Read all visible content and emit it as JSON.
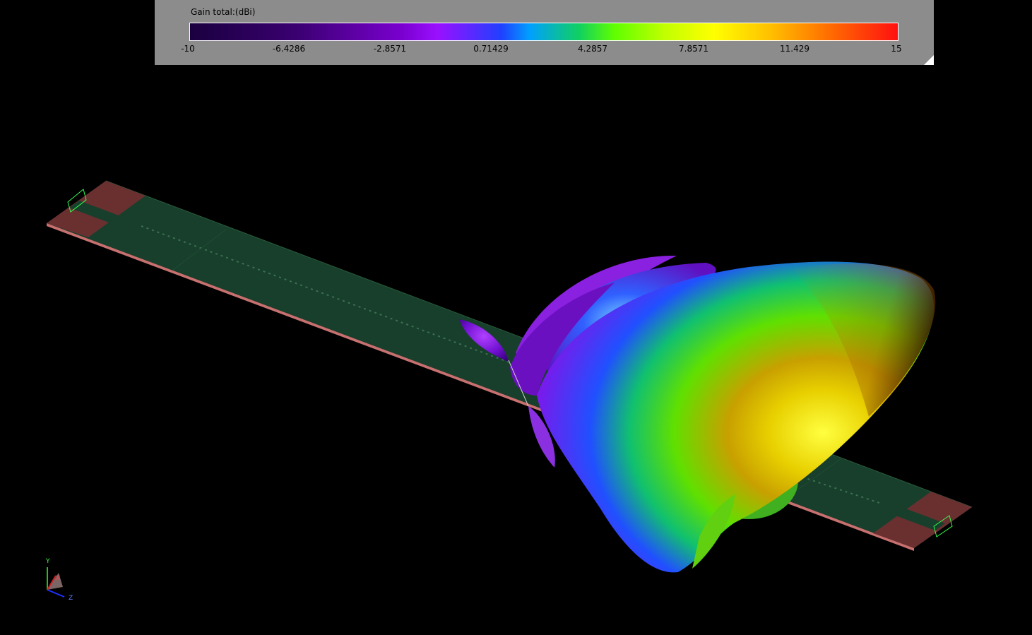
{
  "legend": {
    "title": "Gain total:(dBi)",
    "ticks": [
      "-10",
      "-6.4286",
      "-2.8571",
      "0.71429",
      "4.2857",
      "7.8571",
      "11.429",
      "15"
    ],
    "min": -10,
    "max": 15
  },
  "axes": {
    "x_label": "X",
    "y_label": "Y",
    "z_label": "Z"
  },
  "colors": {
    "board": "#173f2b",
    "port_pad": "#6a3030",
    "background": "#000000"
  }
}
